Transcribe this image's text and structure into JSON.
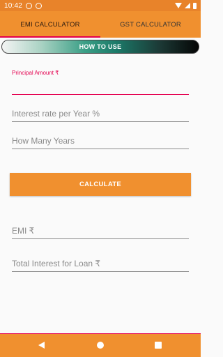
{
  "status_bar": {
    "time": "10:42",
    "icons": [
      "sim-icon",
      "alarm-icon",
      "wifi-icon",
      "signal-icon",
      "battery-icon"
    ]
  },
  "tabs": [
    {
      "label": "EMI CALCULATOR",
      "active": true
    },
    {
      "label": "GST CALCULATOR",
      "active": false
    }
  ],
  "how_to_use_label": "HOW TO USE",
  "form": {
    "principal_label": "Principal Amount ₹",
    "principal_value": "",
    "interest_placeholder": "Interest rate per Year %",
    "years_placeholder": "How Many Years"
  },
  "calculate_label": "CALCULATE",
  "results": {
    "emi_placeholder": "EMI ₹",
    "total_interest_placeholder": "Total Interest for Loan ₹"
  },
  "colors": {
    "primary": "#f0902f",
    "accent": "#e4004f",
    "status_bar": "#e8832a"
  },
  "nav_bar": {
    "buttons": [
      "back-icon",
      "home-icon",
      "recents-icon"
    ]
  }
}
